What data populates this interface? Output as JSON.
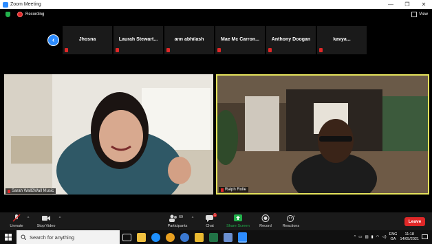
{
  "window": {
    "title": "Zoom Meeting",
    "controls": [
      "—",
      "❐",
      "✕"
    ]
  },
  "topbar": {
    "recording_label": "Recording",
    "view_label": "View"
  },
  "participants_strip": [
    {
      "name": "Jhosna"
    },
    {
      "name": "Laurah  Stewart..."
    },
    {
      "name": "ann abhilash"
    },
    {
      "name": "Mae  Mc Carron..."
    },
    {
      "name": "Anthony Doogan"
    },
    {
      "name": "kavya..."
    }
  ],
  "videos": [
    {
      "label": "Sarah Wall2Wall Music"
    },
    {
      "label": "Ralph Rolle"
    }
  ],
  "controls": {
    "unmute": "Unmute",
    "stop_video": "Stop Video",
    "participants": "Participants",
    "participants_count": "69",
    "chat": "Chat",
    "chat_badge": "1",
    "share_screen": "Share Screen",
    "record": "Record",
    "reactions": "Reactions",
    "leave": "Leave"
  },
  "taskbar": {
    "search_placeholder": "Search for anything",
    "lang_top": "ENG",
    "lang_bottom": "GA",
    "time": "11:18",
    "date": "14/05/2021"
  },
  "colors": {
    "accent": "#2d8cff",
    "danger": "#e02828",
    "active_speaker": "#e5e35c",
    "share": "#22b14c"
  }
}
